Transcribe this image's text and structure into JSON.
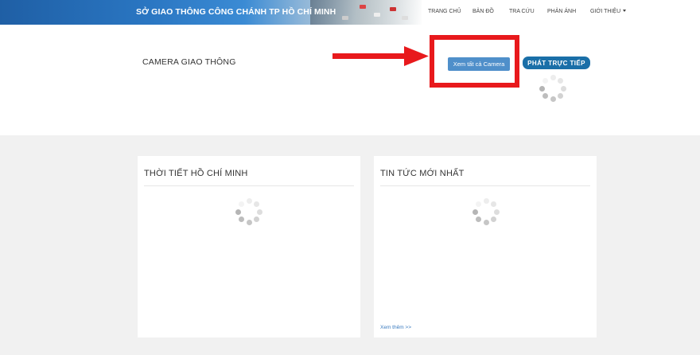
{
  "header": {
    "site_title": "SỞ GIAO THÔNG CÔNG CHÁNH TP HỒ CHÍ MINH",
    "nav": [
      {
        "label": "TRANG CHỦ"
      },
      {
        "label": "BẢN ĐỒ"
      },
      {
        "label": "TRA CỨU"
      },
      {
        "label": "PHẢN ÁNH"
      },
      {
        "label": "GIỚI THIỆU"
      }
    ]
  },
  "camera_section": {
    "title": "CAMERA GIAO THÔNG",
    "view_all_button": "Xem tất cả Camera",
    "live_button": "PHÁT TRỰC TIẾP"
  },
  "weather_card": {
    "title": "THỜI TIẾT HỒ CHÍ MINH"
  },
  "news_card": {
    "title": "TIN TỨC MỚI NHẤT",
    "more_link": "Xem thêm >>"
  },
  "colors": {
    "annotation_red": "#e8191c",
    "primary_button": "#4f8fca",
    "live_button": "#1a6fa8",
    "link": "#3a7bbf"
  }
}
